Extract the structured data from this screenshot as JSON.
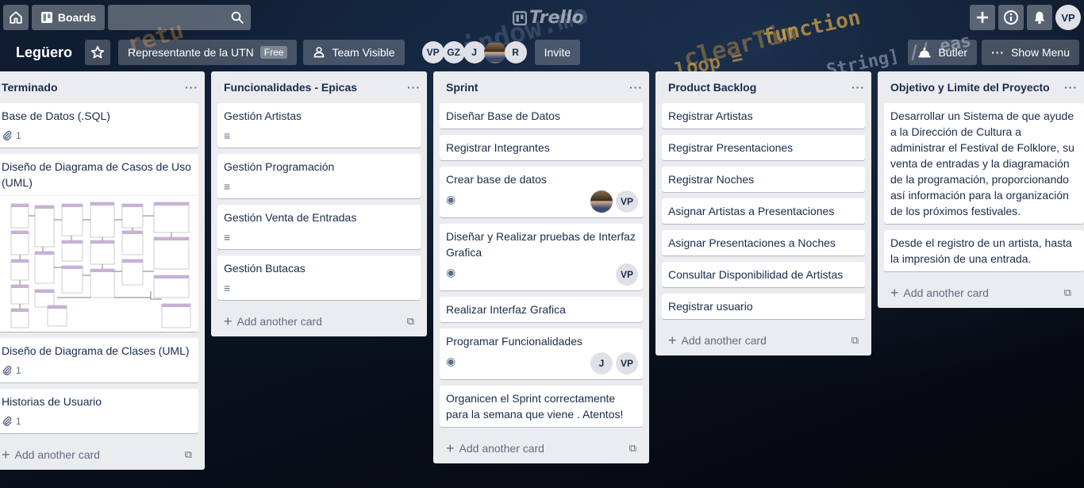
{
  "header": {
    "boards_label": "Boards",
    "logo_text": "Trello",
    "user_initials": "VP"
  },
  "board": {
    "title": "Legüero",
    "org_label": "Representante de la UTN",
    "org_badge": "Free",
    "visibility_label": "Team Visible",
    "members": [
      "VP",
      "GZ",
      "J",
      "",
      "R"
    ],
    "invite_label": "Invite",
    "butler_label": "Butler",
    "show_menu_label": "Show Menu"
  },
  "add_card_label": "Add another card",
  "lists": [
    {
      "title": "Terminado",
      "cards": [
        {
          "title": "Base de Datos (.SQL)",
          "attachments": "1"
        },
        {
          "title": "Diseño de Diagrama de Casos de Uso (UML)"
        },
        {
          "title": "Diseño de Diagrama de Clases (UML)",
          "attachments": "1"
        },
        {
          "title": "Historias de Usuario",
          "attachments": "1"
        }
      ]
    },
    {
      "title": "Funcionalidades - Epicas",
      "cards": [
        {
          "title": "Gestión Artistas"
        },
        {
          "title": "Gestión Programación"
        },
        {
          "title": "Gestión Venta de Entradas"
        },
        {
          "title": "Gestión Butacas"
        }
      ]
    },
    {
      "title": "Sprint",
      "cards": [
        {
          "title": "Diseñar Base de Datos"
        },
        {
          "title": "Registrar Integrantes"
        },
        {
          "title": "Crear base de datos",
          "members": [
            "",
            "VP"
          ]
        },
        {
          "title": "Diseñar y Realizar pruebas de Interfaz Grafica",
          "members": [
            "VP"
          ]
        },
        {
          "title": "Realizar Interfaz Grafica"
        },
        {
          "title": "Programar Funcionalidades",
          "members": [
            "J",
            "VP"
          ]
        },
        {
          "title": "Organicen el Sprint correctamente para la semana que viene . Atentos!"
        }
      ]
    },
    {
      "title": "Product Backlog",
      "cards": [
        {
          "title": "Registrar Artistas"
        },
        {
          "title": "Registrar Presentaciones"
        },
        {
          "title": "Registrar Noches"
        },
        {
          "title": "Asignar Artistas a Presentaciones"
        },
        {
          "title": "Asignar Presentaciones a Noches"
        },
        {
          "title": "Consultar Disponibilidad de Artistas"
        },
        {
          "title": "Registrar usuario"
        }
      ]
    },
    {
      "title": "Objetivo y Limite del Proyecto",
      "cards": [
        {
          "title": "Desarrollar un Sistema de que ayude a la Dirección de Cultura a administrar el Festival de Folklore, su venta de entradas y la diagramación de la programación, proporcionando así información para la organización de los próximos festivales."
        },
        {
          "title": "Desde el registro de un artista, hasta la impresión de una entrada."
        }
      ]
    }
  ]
}
